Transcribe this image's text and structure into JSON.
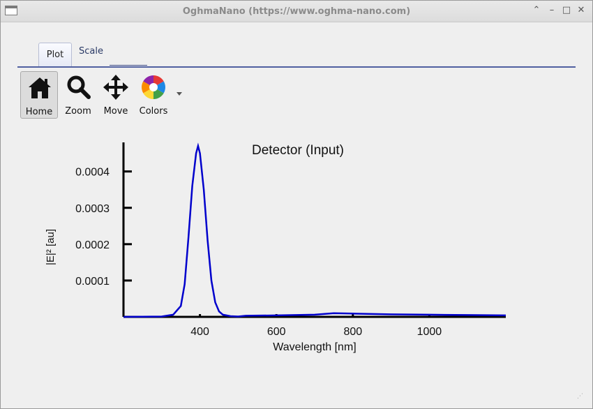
{
  "window": {
    "title": "OghmaNano (https://www.oghma-nano.com)"
  },
  "tabs": [
    {
      "label": "Plot",
      "active": true
    },
    {
      "label": "Scale",
      "active": false
    }
  ],
  "toolbar": {
    "home_label": "Home",
    "zoom_label": "Zoom",
    "move_label": "Move",
    "colors_label": "Colors",
    "icons": [
      "home-icon",
      "zoom-icon",
      "move-icon",
      "colors-icon"
    ]
  },
  "chart_data": {
    "type": "line",
    "title": "Detector (Input)",
    "xlabel": "Wavelength [nm]",
    "ylabel": "|E|² [au]",
    "xlim": [
      200,
      1200
    ],
    "ylim": [
      0,
      0.00048
    ],
    "xticks": [
      400,
      600,
      800,
      1000
    ],
    "xtick_labels": [
      "400",
      "600",
      "800",
      "1000"
    ],
    "yticks": [
      0.0001,
      0.0002,
      0.0003,
      0.0004
    ],
    "ytick_labels": [
      "0.0001",
      "0.0002",
      "0.0003",
      "0.0004"
    ],
    "grid": false,
    "color": "#0000cc",
    "series": [
      {
        "x": [
          200,
          300,
          330,
          350,
          360,
          370,
          380,
          390,
          395,
          400,
          410,
          420,
          430,
          440,
          450,
          460,
          480,
          500,
          520,
          600,
          700,
          750,
          800,
          900,
          1000,
          1100,
          1200
        ],
        "y": [
          0,
          1e-06,
          6e-06,
          3e-05,
          9e-05,
          0.00022,
          0.00036,
          0.00045,
          0.00047,
          0.00045,
          0.00035,
          0.00021,
          0.0001,
          4e-05,
          1.5e-05,
          6e-06,
          2e-06,
          1e-06,
          3e-06,
          4e-06,
          6e-06,
          1e-05,
          9e-06,
          7e-06,
          6e-06,
          5e-06,
          4e-06
        ]
      }
    ]
  }
}
